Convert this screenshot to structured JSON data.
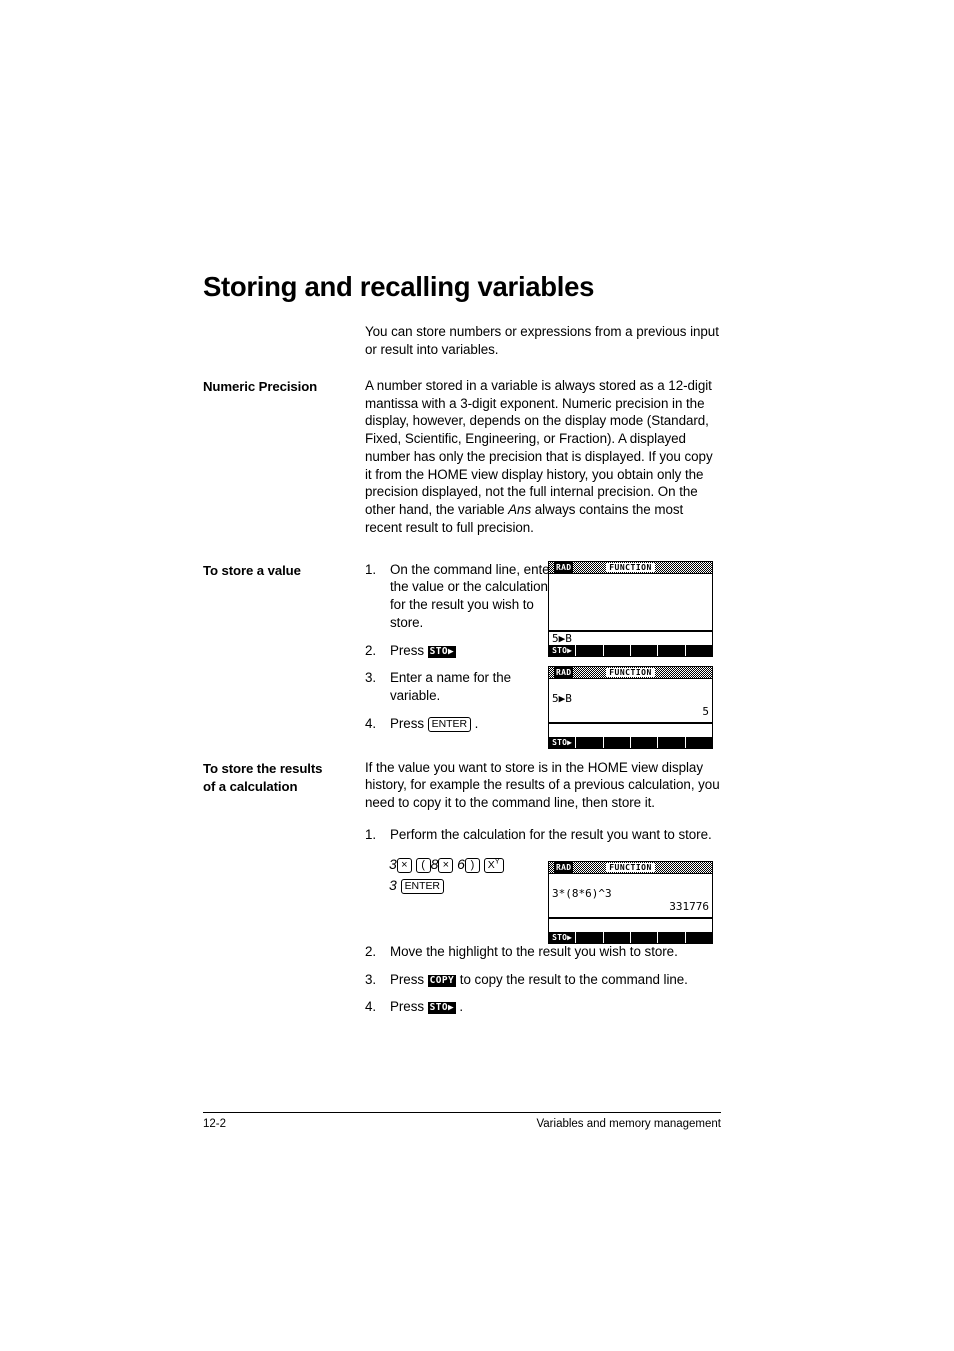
{
  "page": {
    "title": "Storing and recalling variables",
    "intro": "You can store numbers or expressions from a previous input or result into variables."
  },
  "sections": {
    "numeric_precision": {
      "label": "Numeric Precision",
      "body_part1": "A number stored in a variable is always stored as a 12-digit mantissa with a 3-digit exponent. Numeric precision in the display, however, depends on the display mode (Standard, Fixed, Scientific, Engineering, or Fraction). A displayed number has only the precision that is displayed. If you copy it from the HOME view display history, you obtain only the precision displayed, not the full internal precision. On the other hand, the variable ",
      "body_italic": "Ans",
      "body_part2": " always contains the most recent result to full precision."
    },
    "store_value": {
      "label": "To store a value",
      "steps": [
        {
          "num": "1.",
          "text": "On the command line, enter the value or the calculation for the result you wish to store."
        },
        {
          "num": "2.",
          "pre": "Press ",
          "key": "STO",
          "key_arrow": "▶",
          "post": ""
        },
        {
          "num": "3.",
          "text": "Enter a name for the variable."
        },
        {
          "num": "4.",
          "pre": "Press ",
          "keybox": "ENTER",
          "post": " ."
        }
      ]
    },
    "store_results": {
      "label_line1": "To store the results",
      "label_line2": "of a calculation",
      "body": "If the value you want to store is in the HOME view display history, for example the results of a previous calculation, you need to copy it to the command line, then store it.",
      "steps_before": [
        {
          "num": "1.",
          "text": "Perform the calculation for the result you want to store."
        }
      ],
      "keystrokes": {
        "line1": [
          {
            "type": "lit",
            "text": "3"
          },
          {
            "type": "keybox",
            "text": "×"
          },
          {
            "type": "space"
          },
          {
            "type": "keybox",
            "text": "("
          },
          {
            "type": "lit",
            "text": "8"
          },
          {
            "type": "keybox",
            "text": "×"
          },
          {
            "type": "lit",
            "text": " 6"
          },
          {
            "type": "keybox",
            "text": ")"
          },
          {
            "type": "space"
          },
          {
            "type": "keybox-italic",
            "base": "X",
            "sup": "Y"
          }
        ],
        "line2": [
          {
            "type": "lit",
            "text": "3"
          },
          {
            "type": "space"
          },
          {
            "type": "keybox",
            "text": "ENTER"
          }
        ]
      },
      "steps_after": [
        {
          "num": "2.",
          "text": "Move the highlight to the result you wish to store."
        },
        {
          "num": "3.",
          "pre": "Press ",
          "key": "COPY",
          "post": " to copy the result to the command line."
        },
        {
          "num": "4.",
          "pre": "Press ",
          "key": "STO",
          "key_arrow": "▶",
          "post": " ."
        }
      ]
    }
  },
  "calculators": [
    {
      "id": "calc-1",
      "mode": "RAD",
      "app": "FUNCTION",
      "history": [],
      "history_height": 56,
      "command_line": "5▶B",
      "menu": [
        "STO▶",
        "",
        "",
        "",
        "",
        ""
      ]
    },
    {
      "id": "calc-2",
      "mode": "RAD",
      "app": "FUNCTION",
      "history": [
        {
          "text": "",
          "align": "left"
        },
        {
          "text": "5▶B",
          "align": "left"
        },
        {
          "text": "5",
          "align": "right"
        }
      ],
      "history_height": 43,
      "command_line": "",
      "menu": [
        "STO▶",
        "",
        "",
        "",
        "",
        ""
      ]
    },
    {
      "id": "calc-3",
      "mode": "RAD",
      "app": "FUNCTION",
      "history": [
        {
          "text": "",
          "align": "left"
        },
        {
          "text": "3*(8*6)^3",
          "align": "left"
        },
        {
          "text": "331776",
          "align": "right"
        }
      ],
      "history_height": 43,
      "command_line": "",
      "menu": [
        "STO▶",
        "",
        "",
        "",
        "",
        ""
      ]
    }
  ],
  "footer": {
    "page_number": "12-2",
    "chapter": "Variables and memory management"
  }
}
